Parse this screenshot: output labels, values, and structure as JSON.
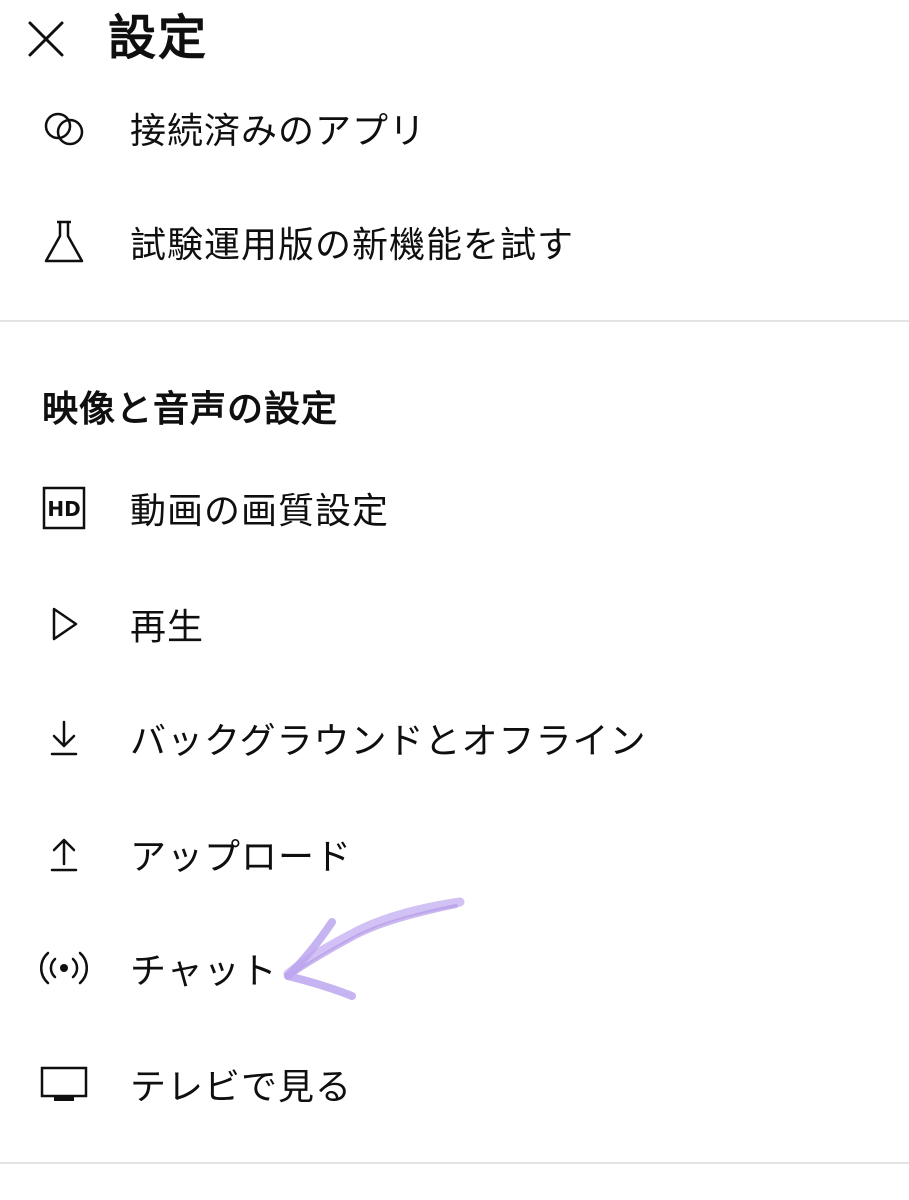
{
  "header": {
    "title": "設定"
  },
  "items_top": [
    {
      "label": "接続済みのアプリ"
    },
    {
      "label": "試験運用版の新機能を試す"
    }
  ],
  "section": {
    "heading": "映像と音声の設定",
    "items": [
      {
        "label": "動画の画質設定"
      },
      {
        "label": "再生"
      },
      {
        "label": "バックグラウンドとオフライン"
      },
      {
        "label": "アップロード"
      },
      {
        "label": "チャット"
      },
      {
        "label": "テレビで見る"
      }
    ]
  },
  "icons": {
    "close": "close-icon",
    "connected_apps": "overlapping-circles-icon",
    "experimental": "flask-icon",
    "quality": "hd-icon",
    "playback": "play-icon",
    "background_offline": "download-icon",
    "upload": "upload-icon",
    "chat": "broadcast-icon",
    "tv": "tv-icon"
  },
  "colors": {
    "text": "#0f0f0f",
    "divider": "#e3e3e3",
    "annotation_arrow": "#b8a2ea"
  }
}
